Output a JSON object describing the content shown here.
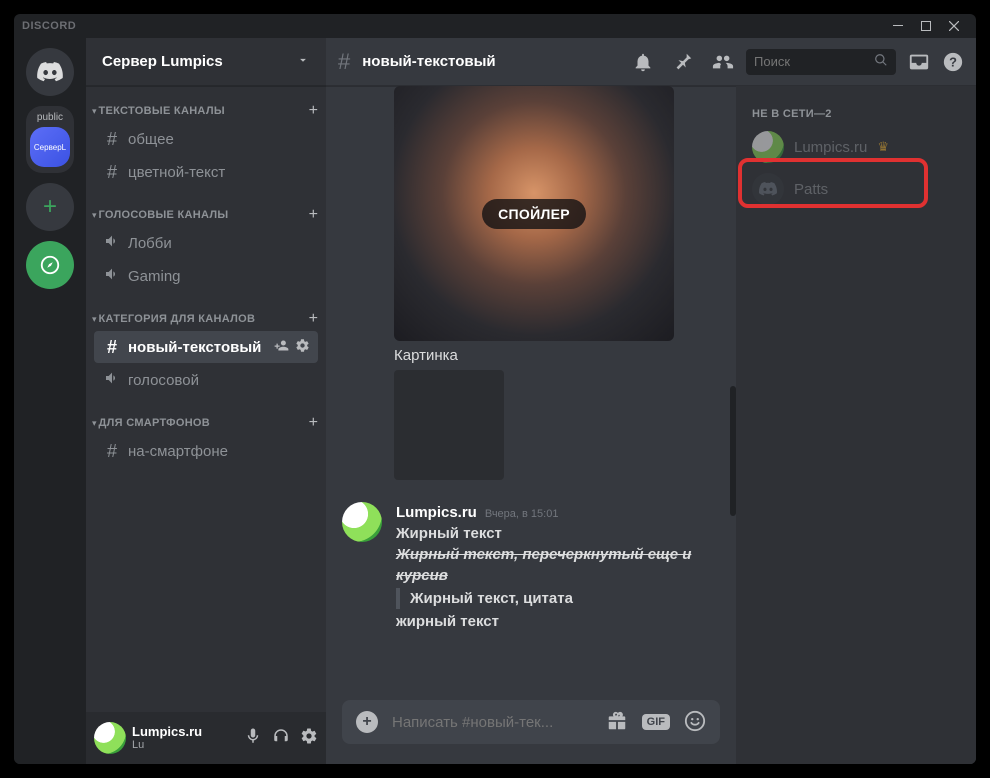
{
  "titlebar": {
    "brand": "DISCORD"
  },
  "guilds": {
    "folder_label": "public",
    "folder_server": "СерверL"
  },
  "server": {
    "name": "Сервер Lumpics"
  },
  "categories": [
    {
      "name": "ТЕКСТОВЫЕ КАНАЛЫ",
      "channels": [
        {
          "type": "text",
          "name": "общее"
        },
        {
          "type": "text",
          "name": "цветной-текст"
        }
      ]
    },
    {
      "name": "ГОЛОСОВЫЕ КАНАЛЫ",
      "channels": [
        {
          "type": "voice",
          "name": "Лобби"
        },
        {
          "type": "voice",
          "name": "Gaming"
        }
      ]
    },
    {
      "name": "КАТЕГОРИЯ ДЛЯ КАНАЛОВ",
      "channels": [
        {
          "type": "text",
          "name": "новый-текстовый",
          "active": true
        },
        {
          "type": "voice",
          "name": "голосовой"
        }
      ]
    },
    {
      "name": "ДЛЯ СМАРТФОНОВ",
      "channels": [
        {
          "type": "text",
          "name": "на-смартфоне"
        }
      ]
    }
  ],
  "user_panel": {
    "name": "Lumpics.ru",
    "sub": "Lu"
  },
  "chat_header": {
    "channel": "новый-текстовый",
    "search_placeholder": "Поиск"
  },
  "spoiler": {
    "label": "СПОЙЛЕР"
  },
  "caption": "Картинка",
  "message": {
    "author": "Lumpics.ru",
    "timestamp": "Вчера, в 15:01",
    "line1": "Жирный текст",
    "line2": "Жирный текст, перечеркнутый еще и курсив",
    "line3": "Жирный текст, цитата",
    "line4": "жирный текст"
  },
  "composer": {
    "placeholder": "Написать #новый-тек...",
    "gif": "GIF"
  },
  "members": {
    "heading": "НЕ В СЕТИ—2",
    "list": [
      {
        "name": "Lumpics.ru",
        "owner": true
      },
      {
        "name": "Patts",
        "owner": false
      }
    ]
  }
}
